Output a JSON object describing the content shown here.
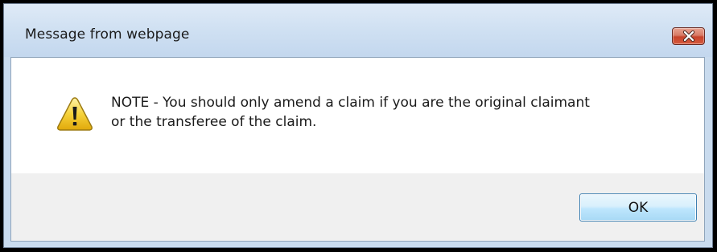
{
  "dialog": {
    "title": "Message from webpage",
    "icon": "warning-icon",
    "message_lines": [
      "NOTE - You should only amend a claim if you are the original claimant",
      "or the transferee of the claim."
    ],
    "ok_label": "OK",
    "close_icon": "close-icon"
  },
  "colors": {
    "close_button": "#c7432b",
    "warning_fill": "#f3c51a",
    "ok_border": "#3c7fb1"
  }
}
